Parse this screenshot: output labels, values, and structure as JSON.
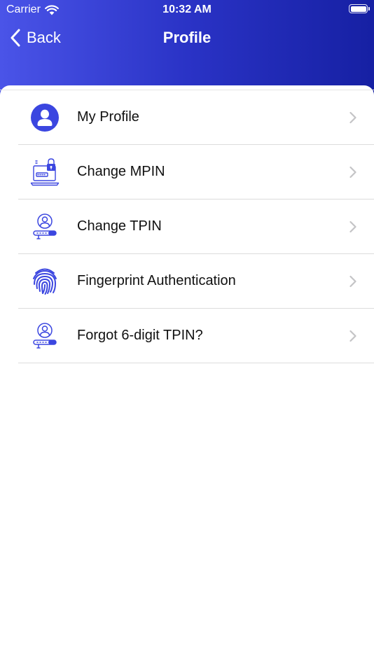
{
  "status_bar": {
    "carrier": "Carrier",
    "time": "10:32 AM"
  },
  "nav": {
    "back_label": "Back",
    "title": "Profile"
  },
  "menu": {
    "items": [
      {
        "label": "My Profile",
        "icon": "user-avatar-icon"
      },
      {
        "label": "Change MPIN",
        "icon": "laptop-lock-icon"
      },
      {
        "label": "Change TPIN",
        "icon": "user-pin-icon"
      },
      {
        "label": "Fingerprint Authentication",
        "icon": "fingerprint-icon"
      },
      {
        "label": "Forgot 6-digit TPIN?",
        "icon": "user-pin-icon"
      }
    ]
  },
  "colors": {
    "accent": "#3b46e0",
    "header_start": "#4a54e8",
    "header_end": "#1620a3",
    "chevron": "#c4c4c6",
    "divider": "#dcdcdc"
  }
}
